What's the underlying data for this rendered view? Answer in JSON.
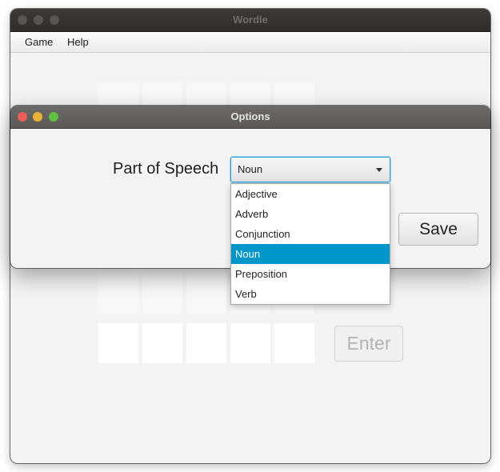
{
  "window": {
    "title": "Wordle"
  },
  "menubar": {
    "items": [
      {
        "label": "Game"
      },
      {
        "label": "Help"
      }
    ]
  },
  "board": {
    "enter_label": "Enter"
  },
  "dialog": {
    "title": "Options",
    "field_label": "Part of Speech",
    "selected_value": "Noun",
    "save_label": "Save"
  },
  "dropdown": {
    "options": [
      "Adjective",
      "Adverb",
      "Conjunction",
      "Noun",
      "Preposition",
      "Verb"
    ],
    "highlighted_index": 3
  },
  "colors": {
    "highlight": "#0096c9",
    "focus_border": "#2a9fd6",
    "traffic_close": "#ec5f56",
    "traffic_minimize": "#e8b234",
    "traffic_maximize": "#5fc040"
  }
}
